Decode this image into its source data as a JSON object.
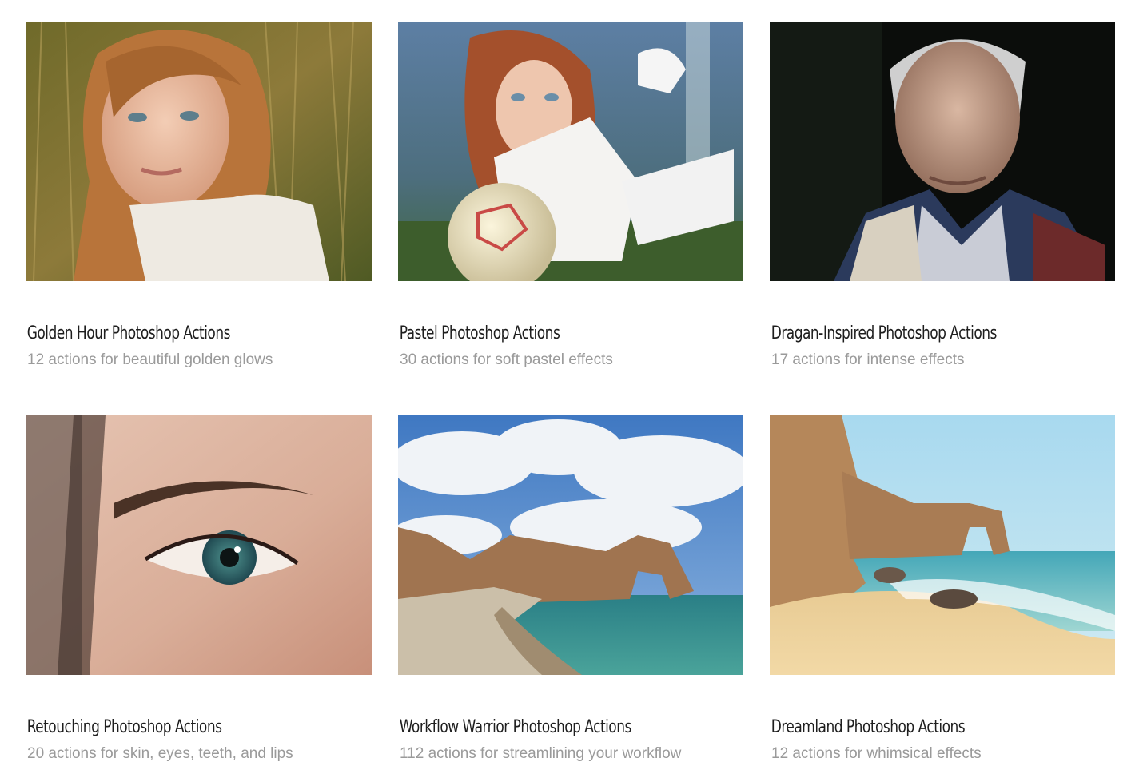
{
  "products": [
    {
      "title": "Golden Hour Photoshop Actions",
      "subtitle": "12 actions for beautiful golden glows",
      "image": "portrait-woman-field-photo"
    },
    {
      "title": "Pastel Photoshop Actions",
      "subtitle": "30 actions for soft pastel effects",
      "image": "woman-with-soccer-ball-photo"
    },
    {
      "title": "Dragan-Inspired Photoshop Actions",
      "subtitle": "17 actions for intense effects",
      "image": "elderly-man-portrait-photo"
    },
    {
      "title": "Retouching Photoshop Actions",
      "subtitle": "20 actions for skin, eyes, teeth, and lips",
      "image": "close-up-eye-photo"
    },
    {
      "title": "Workflow Warrior Photoshop Actions",
      "subtitle": "112 actions for streamlining your workflow",
      "image": "coastal-arch-landscape-photo"
    },
    {
      "title": "Dreamland Photoshop Actions",
      "subtitle": "12 actions for whimsical effects",
      "image": "beach-cliffs-arch-photo"
    }
  ]
}
